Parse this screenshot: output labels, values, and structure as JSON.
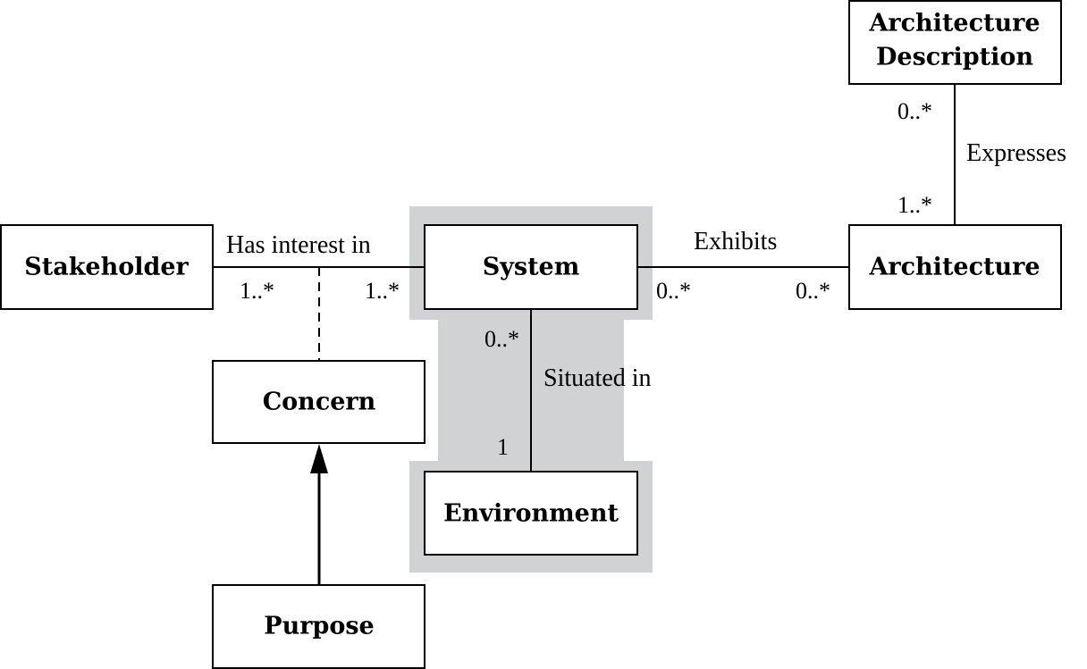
{
  "colors": {
    "highlight": "#d1d2d4",
    "line": "#000000",
    "box_fill": "#ffffff"
  },
  "boxes": {
    "stakeholder": "Stakeholder",
    "system": "System",
    "architecture": "Architecture",
    "architecture_description_line1": "Architecture",
    "architecture_description_line2": "Description",
    "concern": "Concern",
    "environment": "Environment",
    "purpose": "Purpose"
  },
  "associations": {
    "has_interest_in": {
      "label": "Has interest in",
      "stakeholder_end": "1..*",
      "system_end": "1..*"
    },
    "exhibits": {
      "label": "Exhibits",
      "system_end": "0..*",
      "architecture_end": "0..*"
    },
    "expresses": {
      "label": "Expresses",
      "description_end": "0..*",
      "architecture_end": "1..*"
    },
    "situated_in": {
      "label": "Situated in",
      "system_end": "0..*",
      "environment_end": "1"
    }
  }
}
